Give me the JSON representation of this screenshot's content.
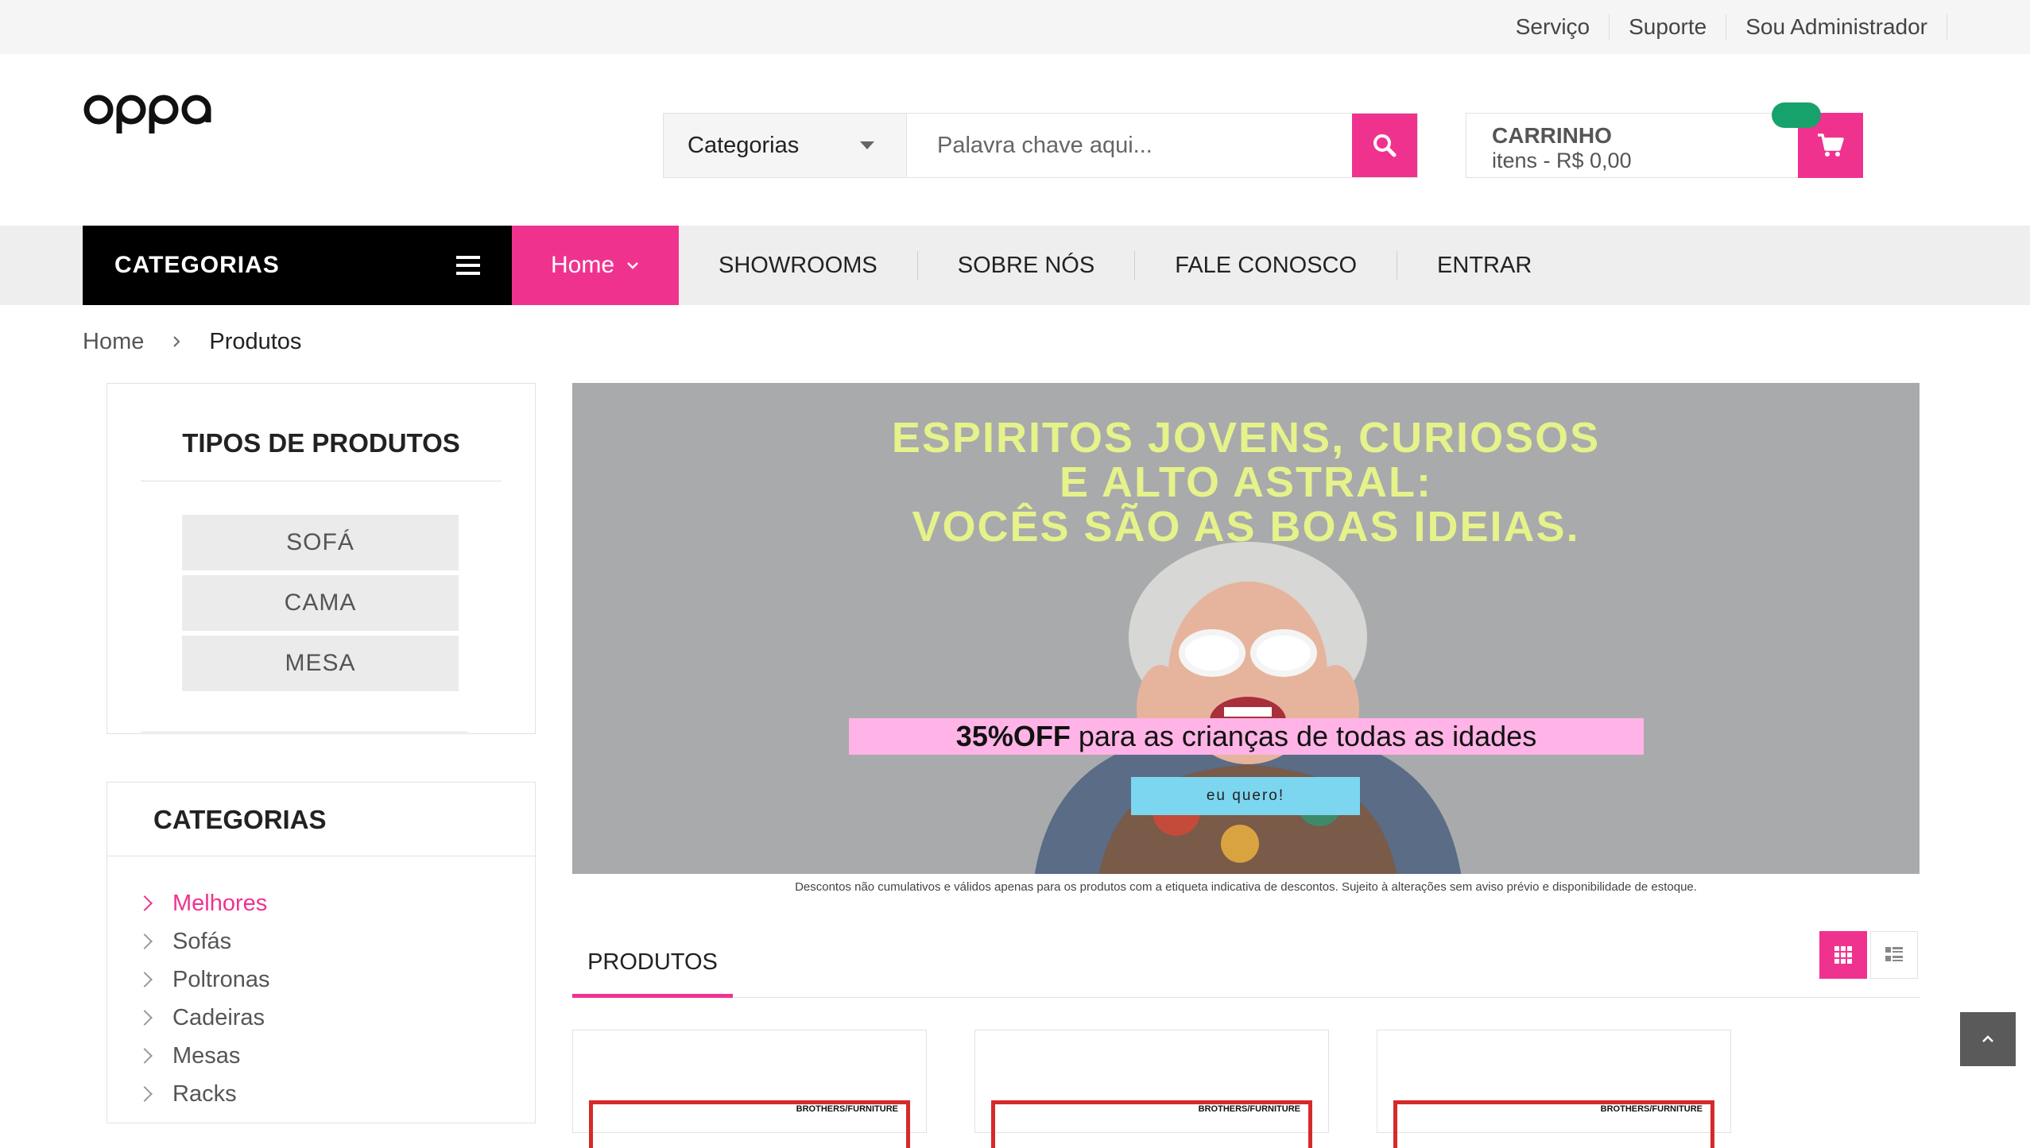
{
  "header": {
    "top_links": [
      "Serviço",
      "Suporte",
      "Sou Administrador"
    ],
    "logo_text": "oppa"
  },
  "search": {
    "category_label": "Categorias",
    "placeholder": "Palavra chave aqui..."
  },
  "cart": {
    "title": "CARRINHO",
    "summary": "itens - R$ 0,00"
  },
  "nav": {
    "categories_label": "CATEGORIAS",
    "home_label": "Home",
    "links": [
      "SHOWROOMS",
      "SOBRE NÓS",
      "FALE CONOSCO",
      "ENTRAR"
    ]
  },
  "breadcrumb": [
    "Home",
    "Produtos"
  ],
  "product_types": {
    "title": "TIPOS DE PRODUTOS",
    "items": [
      "SOFÁ",
      "CAMA",
      "MESA"
    ]
  },
  "categories": {
    "title": "CATEGORIAS",
    "items": [
      "Melhores",
      "Sofás",
      "Poltronas",
      "Cadeiras",
      "Mesas",
      "Racks"
    ],
    "active": "Melhores"
  },
  "banner": {
    "lines": [
      "ESPIRITOS JOVENS, CURIOSOS",
      "E  ALTO ASTRAL:",
      "VOCÊS SÃO AS BOAS IDEIAS."
    ],
    "promo_bold": "35%OFF",
    "promo_rest": " para as crianças de todas as idades",
    "cta": "eu quero!",
    "disclaimer": "Descontos não cumulativos e válidos apenas para os produtos com a etiqueta indicativa de descontos. Sujeito à alterações sem aviso prévio e disponibilidade de estoque."
  },
  "products": {
    "tab_label": "PRODUTOS",
    "card_brand": "BROTHERS/FURNITURE"
  },
  "colors": {
    "accent": "#f0328f",
    "badge": "#17a26b",
    "banner_text": "#e6f28a",
    "promo_bg": "#ffb3e6",
    "cta_bg": "#7dd6ef"
  }
}
